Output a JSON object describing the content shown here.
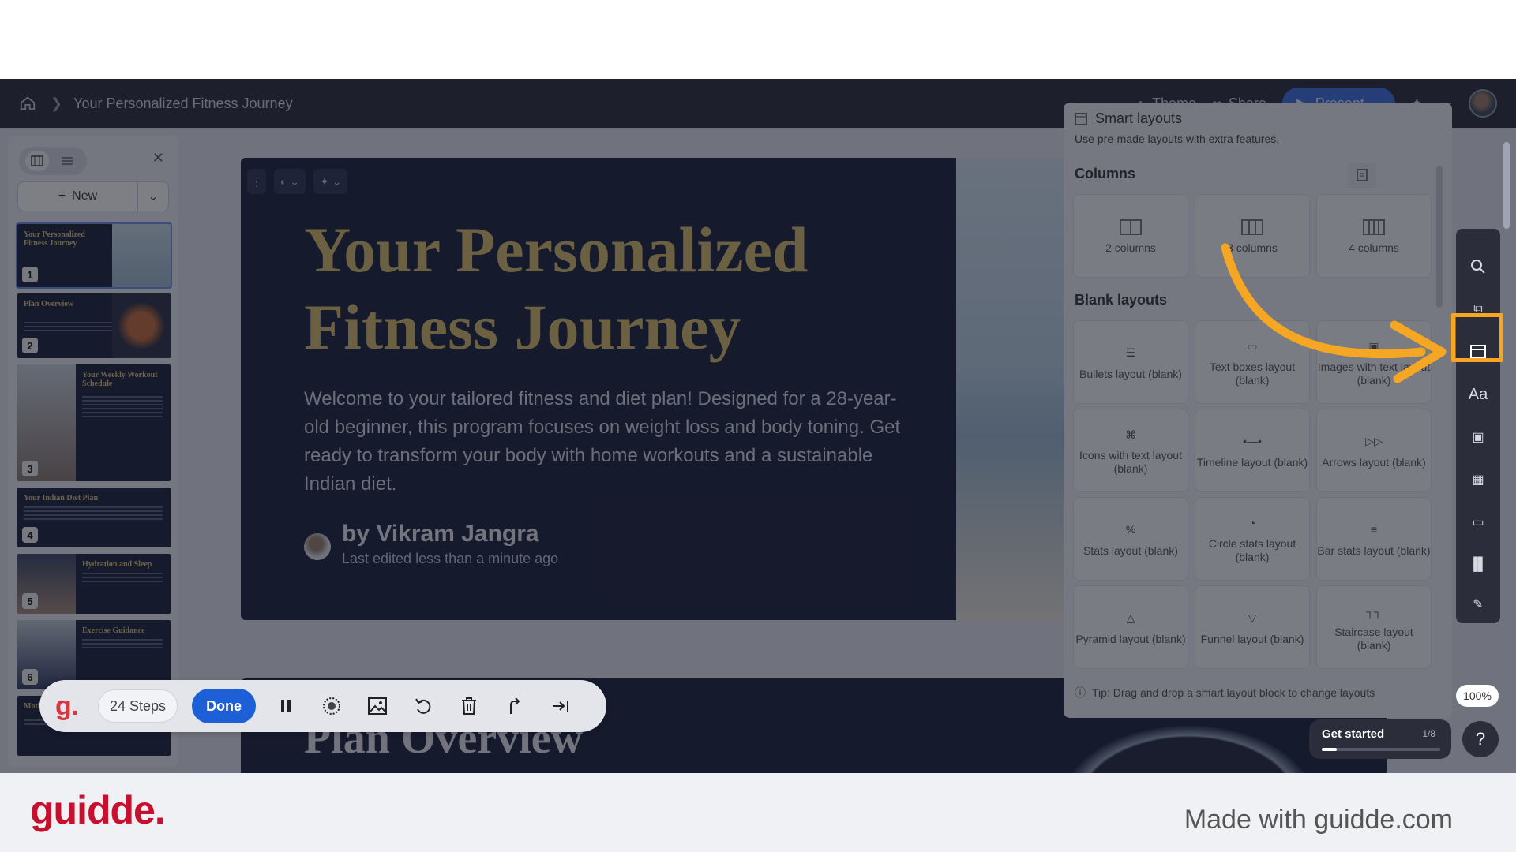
{
  "topbar": {
    "breadcrumb": "Your Personalized Fitness Journey",
    "theme_label": "Theme",
    "share_label": "Share",
    "present_label": "Present"
  },
  "left_panel": {
    "new_label": "New",
    "thumbs": [
      {
        "num": "1",
        "title": "Your Personalized Fitness Journey"
      },
      {
        "num": "2",
        "title": "Plan Overview"
      },
      {
        "num": "3",
        "title": "Your Weekly Workout Schedule"
      },
      {
        "num": "4",
        "title": "Your Indian Diet Plan"
      },
      {
        "num": "5",
        "title": "Hydration and Sleep"
      },
      {
        "num": "6",
        "title": "Exercise Guidance"
      },
      {
        "num": "",
        "title": "Motiv"
      }
    ]
  },
  "slide": {
    "title": "Your Personalized Fitness Journey",
    "body": "Welcome to your tailored fitness and diet plan! Designed for a 28-year-old beginner, this program focuses on weight loss and body toning. Get ready to transform your body with home workouts and a sustainable Indian diet.",
    "author": "by Vikram Jangra",
    "edited": "Last edited less than a minute ago"
  },
  "slide2": {
    "title": "Plan Overview"
  },
  "smart_layouts": {
    "header": "Smart layouts",
    "subtitle": "Use pre-made layouts with extra features.",
    "columns_heading": "Columns",
    "columns": [
      "2 columns",
      "3 columns",
      "4 columns"
    ],
    "blank_heading": "Blank layouts",
    "blank": [
      "Bullets layout (blank)",
      "Text boxes layout (blank)",
      "Images with text layout (blank)",
      "Icons with text layout (blank)",
      "Timeline layout (blank)",
      "Arrows layout (blank)",
      "Stats layout (blank)",
      "Circle stats layout (blank)",
      "Bar stats layout (blank)",
      "Pyramid layout (blank)",
      "Funnel layout (blank)",
      "Staircase layout (blank)"
    ],
    "tip": "Tip: Drag and drop a smart layout block to change layouts"
  },
  "zoom": "100%",
  "get_started": {
    "label": "Get started",
    "count": "1/8",
    "progress": 0.125
  },
  "help": "?",
  "recorder": {
    "logo": "g.",
    "steps": "24 Steps",
    "done": "Done"
  },
  "footer": {
    "logo": "guidde.",
    "made_with": "Made with guidde.com"
  },
  "colors": {
    "highlight": "#f5a623",
    "slide_bg": "#1a1f3d",
    "title_gold": "#d4bc6a",
    "present_blue": "#3b6fe0",
    "guidde_red": "#c8102e"
  }
}
